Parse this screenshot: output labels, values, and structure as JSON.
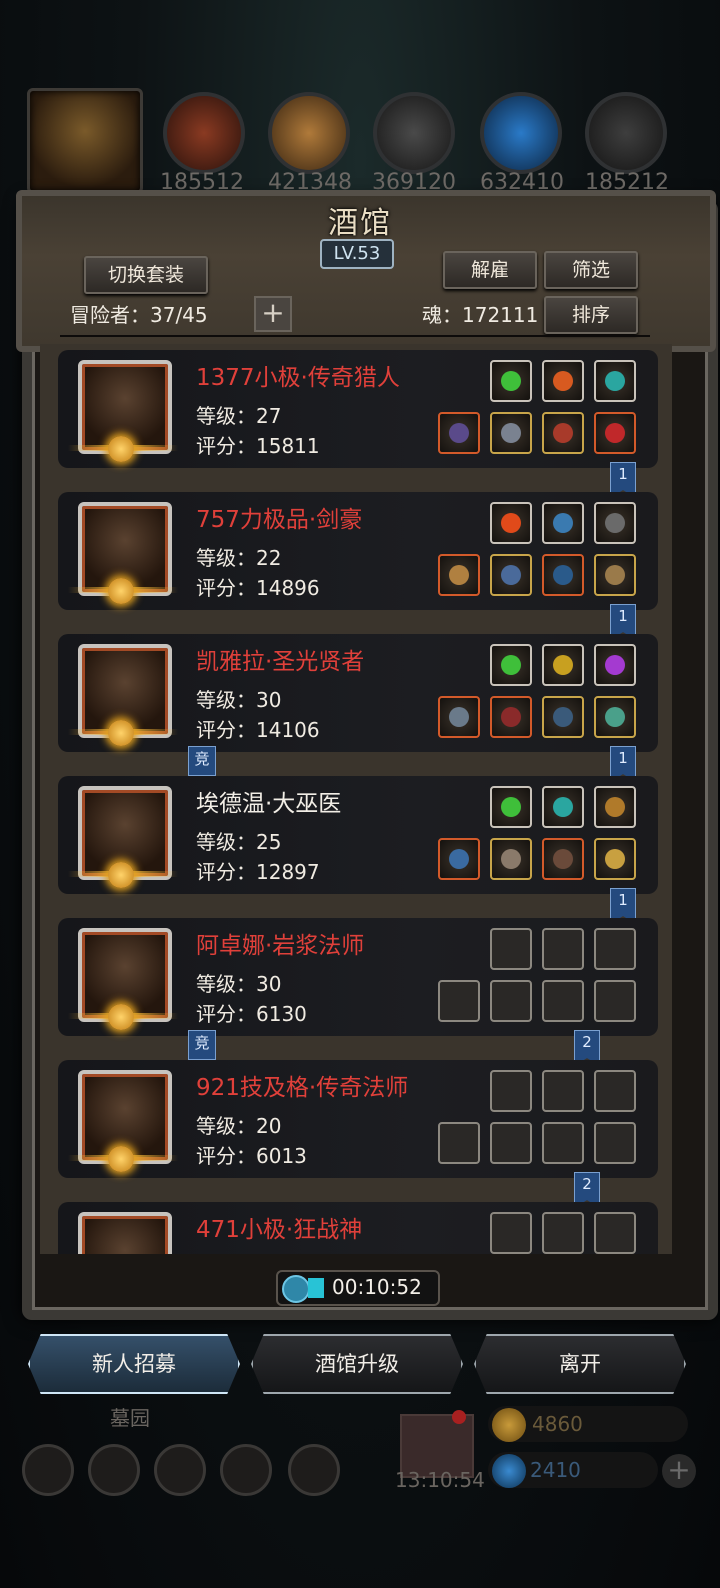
{
  "top_resources": {
    "values": [
      "185512",
      "421348",
      "369120",
      "632410",
      "185212"
    ]
  },
  "tavern": {
    "title": "酒馆",
    "level": "LV.53",
    "switch_outfit": "切换套装",
    "dismiss": "解雇",
    "filter": "筛选",
    "adventurers_label": "冒险者：37/45",
    "soul_label": "魂：172111",
    "sort": "排序"
  },
  "heroes": [
    {
      "name": "1377小极·传奇猎人",
      "level": "等级：27",
      "score": "评分：15811",
      "ribbon": "1",
      "competitive": false,
      "name_color": "#e0403a"
    },
    {
      "name": "757力极品·剑豪",
      "level": "等级：22",
      "score": "评分：14896",
      "ribbon": "1",
      "competitive": false,
      "name_color": "#e0403a"
    },
    {
      "name": "凯雅拉·圣光贤者",
      "level": "等级：30",
      "score": "评分：14106",
      "ribbon": "1",
      "competitive": true,
      "name_color": "#e0403a"
    },
    {
      "name": "埃德温·大巫医",
      "level": "等级：25",
      "score": "评分：12897",
      "ribbon": "1",
      "competitive": false,
      "name_color": "#f2eee6"
    },
    {
      "name": "阿卓娜·岩浆法师",
      "level": "等级：30",
      "score": "评分：6130",
      "ribbon": "2",
      "competitive": true,
      "name_color": "#e0403a"
    },
    {
      "name": "921技及格·传奇法师",
      "level": "等级：20",
      "score": "评分：6013",
      "ribbon": "2",
      "competitive": false,
      "name_color": "#e0403a"
    },
    {
      "name": "471小极·狂战神",
      "level": "",
      "score": "",
      "ribbon": "",
      "competitive": false,
      "name_color": "#e0403a"
    }
  ],
  "competitive_label": "竞",
  "timer": "00:10:52",
  "buttons": {
    "recruit": "新人招募",
    "upgrade": "酒馆升级",
    "leave": "离开"
  },
  "bottom": {
    "graveyard": "墓园",
    "gift_timer": "13:10:54",
    "gold": "4860",
    "gems": "2410"
  }
}
